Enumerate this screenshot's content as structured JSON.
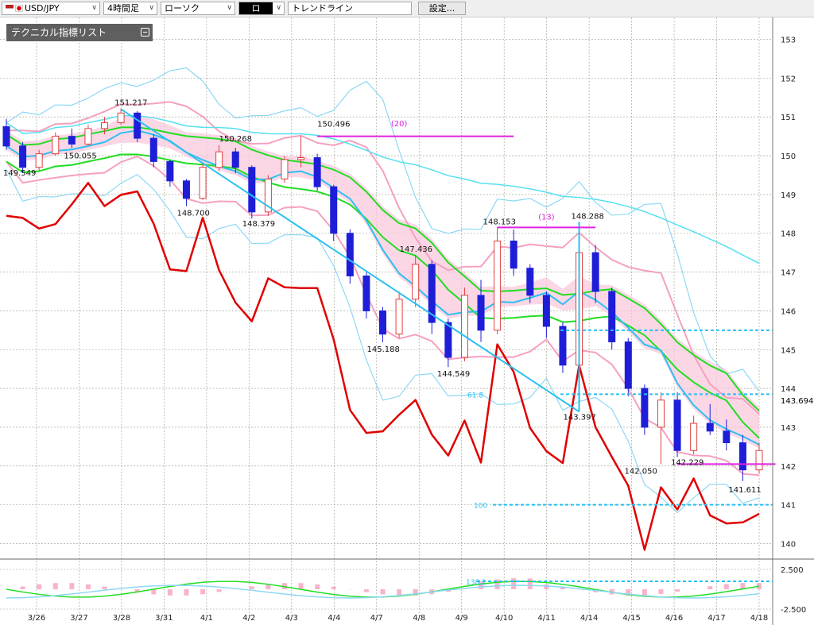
{
  "toolbar": {
    "symbol": "USD/JPY",
    "timeframe": "4時間足",
    "chart_style": "ローソク",
    "draw_mode": "ロ",
    "drawing_tool": "トレンドライン",
    "settings_label": "設定..."
  },
  "indicator_panel": {
    "title": "テクニカル指標リスト"
  },
  "colors": {
    "candle_up": "#e04040",
    "candle_down": "#1e1ed8",
    "rsi_line": "#e00000",
    "ma_short": "#2cc0f0",
    "ma_mid": "#22dd22",
    "ma_long": "#55e0f0",
    "bollinger_outer": "#8dd8f5",
    "bollinger_inner": "#f5a0c0",
    "cloud": "#f9c6dc",
    "cloud_alt": "#bde3f7",
    "marker_magenta": "#e020e0",
    "fib_line": "#25c0f0"
  },
  "chart_data": {
    "type": "candlestick",
    "x": [
      "3/26",
      "3/27",
      "3/28",
      "3/31",
      "4/1",
      "4/2",
      "4/3",
      "4/4",
      "4/7",
      "4/8",
      "4/9",
      "4/10",
      "4/11",
      "4/14",
      "4/15",
      "4/16",
      "4/17",
      "4/18"
    ],
    "ylim": [
      139.6,
      153.4
    ],
    "yticks": [
      153,
      152,
      151,
      150,
      149,
      148,
      147,
      146,
      145,
      144,
      143,
      142,
      141,
      140
    ],
    "current_price": "143.694",
    "price_annotations": [
      "151.217",
      "150.496",
      "150.268",
      "150.055",
      "149.549",
      "148.379",
      "148.700",
      "148.153",
      "148.288",
      "147.436",
      "145.188",
      "144.549",
      "143.397",
      "142.229",
      "142.050",
      "141.611"
    ],
    "marker_labels": [
      "(20)",
      "(13)"
    ],
    "fib_labels": [
      "61.8",
      "100"
    ],
    "lower_pane": {
      "yticks": [
        "2.500",
        "-2.500"
      ],
      "fib_label": "138.2"
    },
    "candles": [
      {
        "o": 150.75,
        "h": 150.95,
        "l": 150.15,
        "c": 150.25
      },
      {
        "o": 150.25,
        "h": 150.35,
        "l": 149.55,
        "c": 149.7
      },
      {
        "o": 149.7,
        "h": 150.15,
        "l": 149.6,
        "c": 150.05
      },
      {
        "o": 150.05,
        "h": 150.6,
        "l": 150.0,
        "c": 150.5
      },
      {
        "o": 150.5,
        "h": 150.7,
        "l": 150.2,
        "c": 150.3
      },
      {
        "o": 150.3,
        "h": 150.8,
        "l": 150.25,
        "c": 150.7
      },
      {
        "o": 150.7,
        "h": 151.0,
        "l": 150.55,
        "c": 150.85
      },
      {
        "o": 150.85,
        "h": 151.22,
        "l": 150.8,
        "c": 151.1
      },
      {
        "o": 151.1,
        "h": 151.15,
        "l": 150.35,
        "c": 150.45
      },
      {
        "o": 150.45,
        "h": 150.55,
        "l": 149.7,
        "c": 149.85
      },
      {
        "o": 149.85,
        "h": 149.9,
        "l": 149.2,
        "c": 149.35
      },
      {
        "o": 149.35,
        "h": 149.4,
        "l": 148.7,
        "c": 148.9
      },
      {
        "o": 148.9,
        "h": 149.8,
        "l": 148.85,
        "c": 149.7
      },
      {
        "o": 149.7,
        "h": 150.27,
        "l": 149.6,
        "c": 150.1
      },
      {
        "o": 150.1,
        "h": 150.2,
        "l": 149.55,
        "c": 149.7
      },
      {
        "o": 149.7,
        "h": 149.75,
        "l": 148.38,
        "c": 148.55
      },
      {
        "o": 148.55,
        "h": 149.5,
        "l": 148.45,
        "c": 149.4
      },
      {
        "o": 149.4,
        "h": 150.0,
        "l": 149.3,
        "c": 149.9
      },
      {
        "o": 149.9,
        "h": 150.5,
        "l": 149.7,
        "c": 149.95
      },
      {
        "o": 149.95,
        "h": 150.05,
        "l": 149.1,
        "c": 149.2
      },
      {
        "o": 149.2,
        "h": 149.25,
        "l": 147.8,
        "c": 148.0
      },
      {
        "o": 148.0,
        "h": 148.1,
        "l": 146.7,
        "c": 146.9
      },
      {
        "o": 146.9,
        "h": 147.0,
        "l": 145.8,
        "c": 146.0
      },
      {
        "o": 146.0,
        "h": 146.1,
        "l": 145.19,
        "c": 145.4
      },
      {
        "o": 145.4,
        "h": 146.5,
        "l": 145.3,
        "c": 146.3
      },
      {
        "o": 146.3,
        "h": 147.44,
        "l": 146.1,
        "c": 147.2
      },
      {
        "o": 147.2,
        "h": 147.3,
        "l": 145.4,
        "c": 145.7
      },
      {
        "o": 145.7,
        "h": 145.8,
        "l": 144.55,
        "c": 144.8
      },
      {
        "o": 144.8,
        "h": 146.6,
        "l": 144.7,
        "c": 146.4
      },
      {
        "o": 146.4,
        "h": 146.8,
        "l": 145.2,
        "c": 145.5
      },
      {
        "o": 145.5,
        "h": 148.15,
        "l": 145.4,
        "c": 147.8
      },
      {
        "o": 147.8,
        "h": 148.1,
        "l": 146.9,
        "c": 147.1
      },
      {
        "o": 147.1,
        "h": 147.2,
        "l": 146.2,
        "c": 146.4
      },
      {
        "o": 146.4,
        "h": 146.5,
        "l": 145.3,
        "c": 145.6
      },
      {
        "o": 145.6,
        "h": 145.7,
        "l": 144.4,
        "c": 144.6
      },
      {
        "o": 144.6,
        "h": 148.29,
        "l": 143.4,
        "c": 147.5
      },
      {
        "o": 147.5,
        "h": 147.7,
        "l": 146.2,
        "c": 146.5
      },
      {
        "o": 146.5,
        "h": 146.6,
        "l": 145.0,
        "c": 145.2
      },
      {
        "o": 145.2,
        "h": 145.3,
        "l": 143.8,
        "c": 144.0
      },
      {
        "o": 144.0,
        "h": 144.1,
        "l": 142.8,
        "c": 143.0
      },
      {
        "o": 143.0,
        "h": 143.9,
        "l": 142.05,
        "c": 143.7
      },
      {
        "o": 143.7,
        "h": 143.9,
        "l": 142.23,
        "c": 142.4
      },
      {
        "o": 142.4,
        "h": 143.3,
        "l": 142.3,
        "c": 143.1
      },
      {
        "o": 143.1,
        "h": 143.6,
        "l": 142.8,
        "c": 142.9
      },
      {
        "o": 142.9,
        "h": 143.2,
        "l": 142.4,
        "c": 142.6
      },
      {
        "o": 142.6,
        "h": 142.8,
        "l": 141.61,
        "c": 141.9
      },
      {
        "o": 141.9,
        "h": 142.6,
        "l": 141.8,
        "c": 142.4
      }
    ]
  }
}
